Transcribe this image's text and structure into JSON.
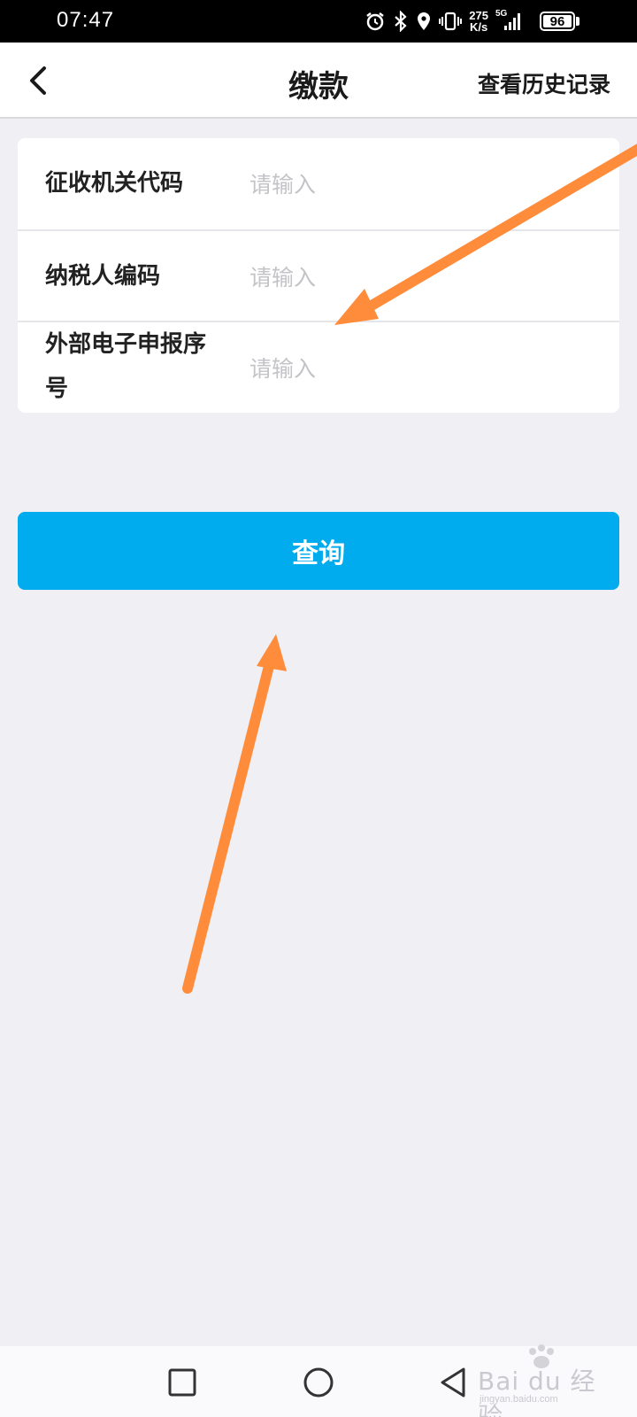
{
  "status_bar": {
    "time": "07:47",
    "net_speed_value": "275",
    "net_speed_unit": "K/s",
    "network_type": "5G",
    "battery_level": "96"
  },
  "header": {
    "title": "缴款",
    "history_link": "查看历史记录"
  },
  "form": {
    "fields": [
      {
        "label": "征收机关代码",
        "placeholder": "请输入",
        "value": ""
      },
      {
        "label": "纳税人编码",
        "placeholder": "请输入",
        "value": ""
      },
      {
        "label": "外部电子申报序号",
        "placeholder": "请输入",
        "value": ""
      }
    ]
  },
  "query_button": {
    "label": "查询"
  },
  "colors": {
    "accent": "#00aced",
    "background": "#efeff4",
    "annotation_arrow": "#ff8c3a"
  },
  "nav_bar": {
    "items": [
      "recent-apps-icon",
      "home-icon",
      "back-triangle-icon"
    ]
  },
  "watermark": {
    "text": "Bai du 经验",
    "subtext": "jingyan.baidu.com"
  }
}
